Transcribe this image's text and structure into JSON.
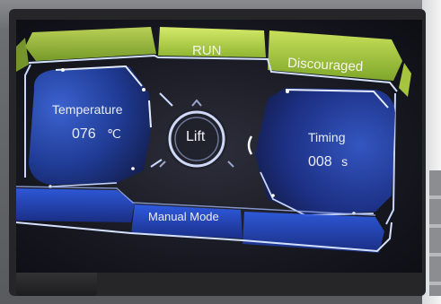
{
  "top_bar": {
    "run_label": "RUN",
    "status_label": "Discouraged"
  },
  "temperature": {
    "label": "Temperature",
    "value": "076",
    "unit": "℃"
  },
  "timing": {
    "label": "Timing",
    "value": "008",
    "unit": "s"
  },
  "center": {
    "lift_label": "Lift"
  },
  "bottom_bar": {
    "mode_label": "Manual Mode"
  },
  "colors": {
    "green_accent": "#9bc43a",
    "blue_accent": "#2a4fc8",
    "outline": "#b9c8ff",
    "text": "#e9ecf6"
  },
  "icons": [
    "lift-ring-icon"
  ]
}
